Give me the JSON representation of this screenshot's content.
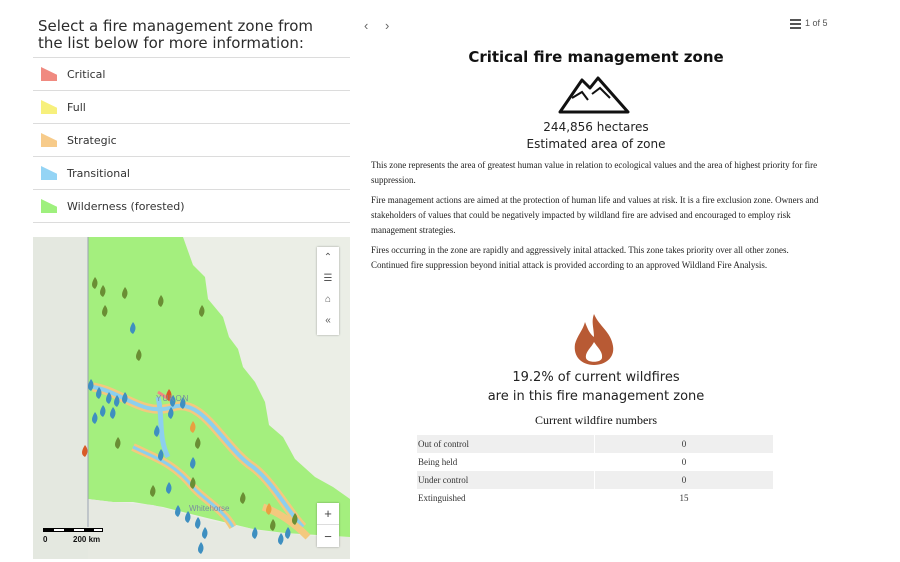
{
  "intro": "Select a fire management zone from the list below for more information:",
  "zones": [
    {
      "label": "Critical",
      "color": "#f08a80"
    },
    {
      "label": "Full",
      "color": "#f7f07c"
    },
    {
      "label": "Strategic",
      "color": "#f7cb8a"
    },
    {
      "label": "Transitional",
      "color": "#94d4f5"
    },
    {
      "label": "Wilderness (forested)",
      "color": "#9ef07d"
    }
  ],
  "map": {
    "region_label": "YUKON",
    "city_label": "Whitehorse",
    "scale_zero": "0",
    "scale_label": "200 km",
    "zoom_in": "+",
    "zoom_out": "−"
  },
  "nav": {
    "prev": "‹",
    "next": "›",
    "pager": "1 of 5"
  },
  "feature": {
    "title": "Critical fire management zone",
    "hectares": "244,856 hectares",
    "estimate_label": "Estimated area of zone",
    "paragraphs": [
      "This zone represents the area of greatest human value in relation to ecological values and the area of highest priority for fire suppression.",
      "Fire management actions are aimed at the protection of human life and values at risk. It is a fire exclusion zone. Owners and stakeholders of values that could be negatively impacted by wildland fire are advised and encouraged to employ risk management strategies.",
      "Fires occurring in the zone are rapidly and aggressively inital attacked. This zone takes priority over all other zones. Continued fire suppression beyond initial attack is provided according to an approved Wildland Fire Analysis."
    ],
    "wildfire_pct_line1": "19.2% of current wildfires",
    "wildfire_pct_line2": "are in this fire management zone",
    "table_title": "Current wildfire numbers",
    "table": [
      {
        "status": "Out of control",
        "count": "0"
      },
      {
        "status": "Being held",
        "count": "0"
      },
      {
        "status": "Under control",
        "count": "0"
      },
      {
        "status": "Extinguished",
        "count": "15"
      }
    ]
  }
}
